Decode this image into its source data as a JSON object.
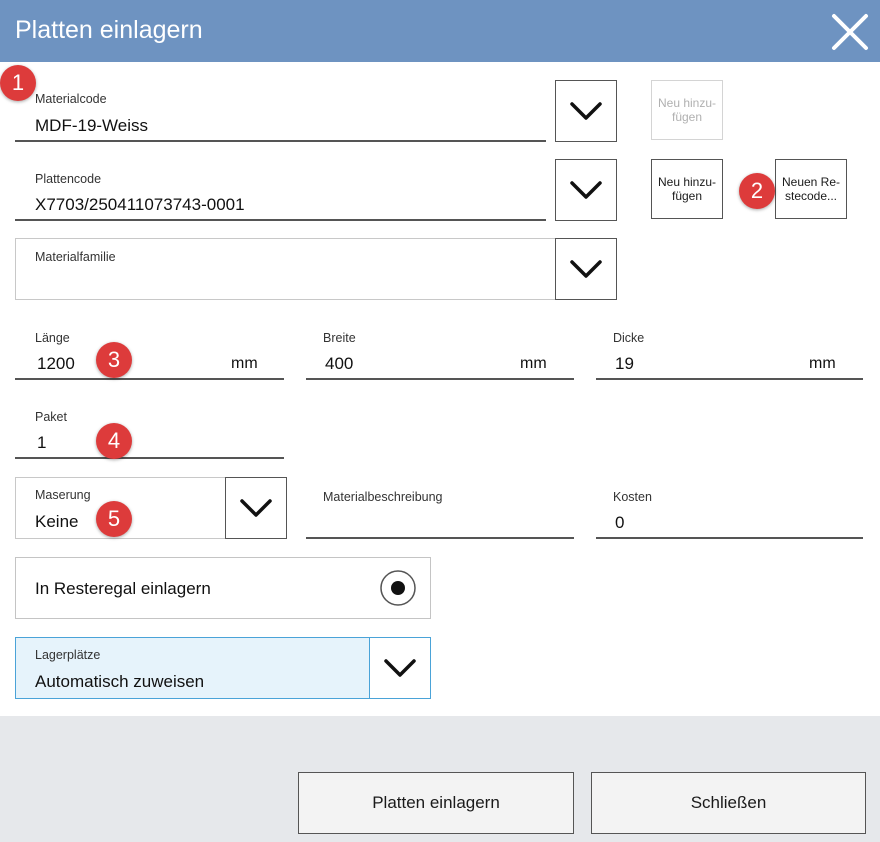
{
  "dialog": {
    "title": "Platten einlagern"
  },
  "fields": {
    "materialcode": {
      "label": "Materialcode",
      "value": "MDF-19-Weiss"
    },
    "plattencode": {
      "label": "Plattencode",
      "value": "X7703/250411073743-0001"
    },
    "materialfamilie": {
      "label": "Materialfamilie",
      "value": ""
    },
    "laenge": {
      "label": "Länge",
      "value": "1200",
      "unit": "mm"
    },
    "breite": {
      "label": "Breite",
      "value": "400",
      "unit": "mm"
    },
    "dicke": {
      "label": "Dicke",
      "value": "19",
      "unit": "mm"
    },
    "paket": {
      "label": "Paket",
      "value": "1"
    },
    "maserung": {
      "label": "Maserung",
      "value": "Keine"
    },
    "materialbeschreibung": {
      "label": "Materialbeschreibung",
      "value": ""
    },
    "kosten": {
      "label": "Kosten",
      "value": "0"
    },
    "resteregal": {
      "label": "In Resteregal einlagern",
      "checked": true
    },
    "lagerplaetze": {
      "label": "Lagerplätze",
      "value": "Automatisch zuweisen"
    }
  },
  "buttons": {
    "neu_hinzufuegen_material": {
      "line1": "Neu hinzu-",
      "line2": "fügen",
      "enabled": false
    },
    "neu_hinzufuegen_platte": {
      "line1": "Neu hinzu-",
      "line2": "fügen",
      "enabled": true
    },
    "neuen_restecode": {
      "line1": "Neuen Re-",
      "line2": "stecode..."
    },
    "platten_einlagern": "Platten einlagern",
    "schliessen": "Schließen"
  },
  "badges": [
    "1",
    "2",
    "3",
    "4",
    "5"
  ],
  "colors": {
    "titlebar": "#6e93c1",
    "badge": "#dd3b3b",
    "accent_border": "#4aa3d8",
    "accent_fill": "#e6f3fb",
    "footer": "#e6e8eb"
  },
  "icons": {
    "close": "close-icon",
    "dropdown": "chevron-down-icon",
    "radio": "radio-selected-icon"
  }
}
